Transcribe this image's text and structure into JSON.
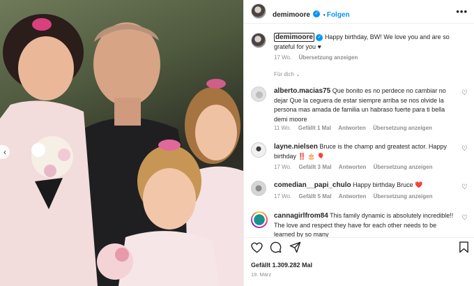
{
  "post": {
    "username": "demimoore",
    "follow_label": "Folgen",
    "more_label": "•••",
    "caption_user": "demimoore",
    "caption_text": "Happy birthday, BW! We love you and are so grateful for you ♥",
    "caption_age": "17 Wo.",
    "caption_translate": "Übersetzung anzeigen",
    "for_you": "Für dich ⌄",
    "likes": "Gefällt 1.309.282 Mal",
    "date": "19. März"
  },
  "comments": [
    {
      "user": "alberto.macias75",
      "text": "Que bonito es no perdece no cambiar no dejar Que la ceguera de estar siempre arriba se nos olvide la persona mas amada de familia un habraso fuerte para ti bella demi moore",
      "age": "11 Wo.",
      "likes": "Gefällt 1 Mal",
      "reply": "Antworten",
      "translate": "Übersetzung anzeigen"
    },
    {
      "user": "layne.nielsen",
      "text": "Bruce is the champ and greatest actor. Happy birthday ‼️ 🎂 🎈",
      "age": "17 Wo.",
      "likes": "Gefällt 3 Mal",
      "reply": "Antworten",
      "translate": "Übersetzung anzeigen"
    },
    {
      "user": "comedian__papi_chulo",
      "text": "Happy birthday Bruce ❤️",
      "age": "17 Wo.",
      "likes": "Gefällt 5 Mal",
      "reply": "Antworten",
      "translate": "Übersetzung anzeigen"
    },
    {
      "user": "cannagirlfrom84",
      "text": "This family dynamic is absolutely incredible!! The love and respect they have for each other needs to be learned by so many"
    }
  ],
  "icons": {
    "heart": "heart-icon",
    "comment": "comment-icon",
    "share": "share-icon",
    "save": "bookmark-icon"
  },
  "colors": {
    "accent": "#0095f6",
    "text": "#262626",
    "muted": "#8e8e8e",
    "like_red": "#ed4956"
  }
}
